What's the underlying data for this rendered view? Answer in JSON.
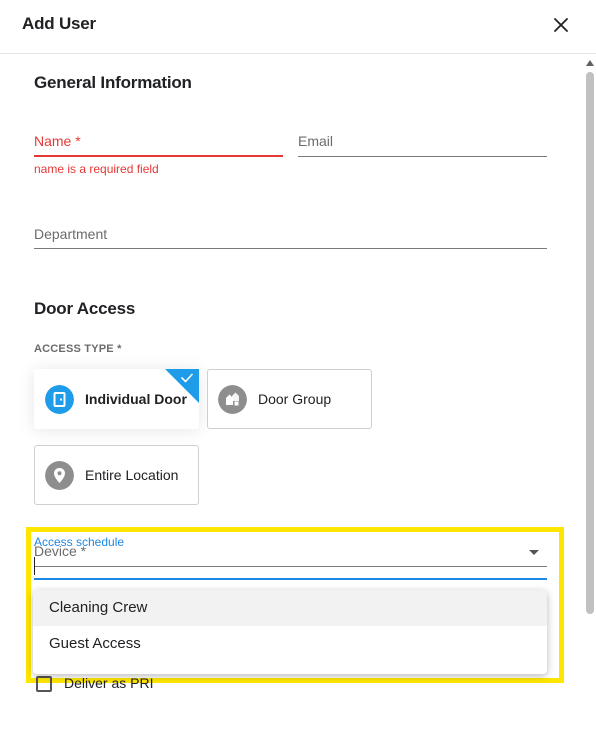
{
  "dialog": {
    "title": "Add User",
    "close_icon": "close-icon"
  },
  "general": {
    "heading": "General Information",
    "name": {
      "label": "Name *",
      "error": "name is a required field",
      "value": ""
    },
    "email": {
      "label": "Email",
      "value": ""
    },
    "department": {
      "label": "Department",
      "value": ""
    }
  },
  "door_access": {
    "heading": "Door Access",
    "access_type_label": "ACCESS TYPE *",
    "options": [
      {
        "label": "Individual Door",
        "icon": "door-icon",
        "selected": true
      },
      {
        "label": "Door Group",
        "icon": "door-group-icon",
        "selected": false
      },
      {
        "label": "Entire Location",
        "icon": "location-pin-icon",
        "selected": false
      }
    ],
    "device": {
      "label": "Device *",
      "value": ""
    },
    "access_schedule": {
      "label": "Access schedule",
      "value": "",
      "options": [
        "Cleaning Crew",
        "Guest Access"
      ]
    },
    "checkbox_label": "Deliver as PRI"
  },
  "colors": {
    "accent": "#1e9be9",
    "error": "#e53935",
    "focus": "#1e88e5",
    "highlight": "#ffe600",
    "icon_gray": "#8e8e8e"
  }
}
